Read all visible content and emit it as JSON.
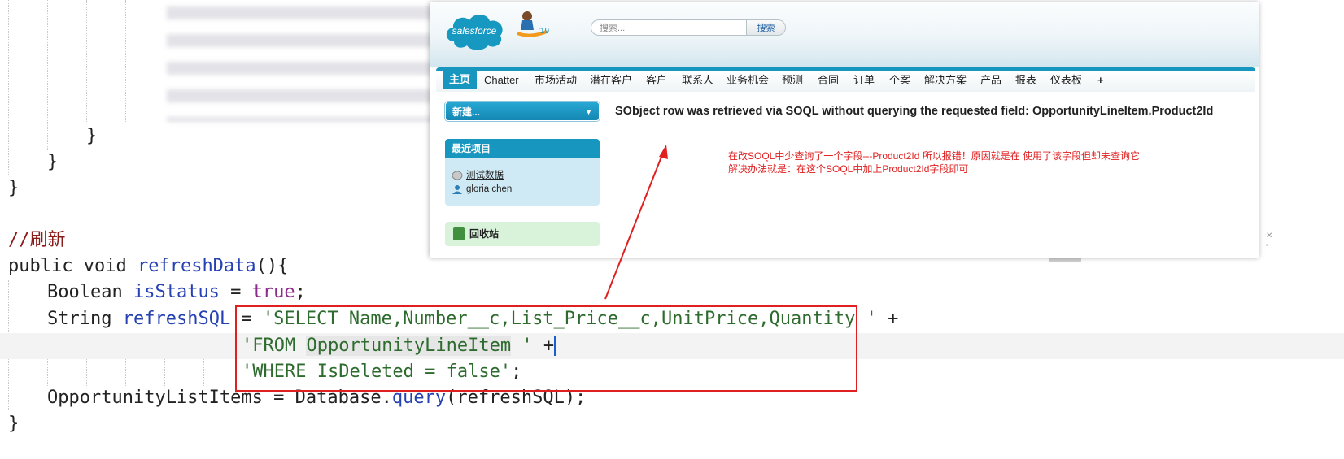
{
  "editor": {
    "brace_inner": "}",
    "brace_mid": "}",
    "brace_outer": "}",
    "comment": "//刷新",
    "decl": {
      "kw_public": "public",
      "kw_void": "void",
      "method": "refreshData",
      "rest": "(){"
    },
    "bool_line": {
      "type": "Boolean",
      "var": "isStatus",
      "eq": " = ",
      "value": "true",
      "end": ";"
    },
    "sql_line1": {
      "type": "String",
      "var": "refreshSQL",
      "eq": " = ",
      "str": "'SELECT Name,Number__c,List_Price__c,UnitPrice,Quantity '",
      "op": " +"
    },
    "sql_line2": {
      "str_a": "'FROM ",
      "str_b": "OpportunityLineItem",
      "str_c": " '",
      "op": " +"
    },
    "sql_line3": {
      "str": "'WHERE IsDeleted = false'",
      "end": ";"
    },
    "query_line": {
      "lhs": "OpportunityListItems",
      "eq": " = ",
      "obj": "Database",
      "dot": ".",
      "method": "query",
      "open": "(",
      "arg": "refreshSQL",
      "close": ");"
    },
    "brace_end": "}"
  },
  "salesforce": {
    "logo_text": "salesforce",
    "release_badge": "'19",
    "search": {
      "placeholder": "搜索...",
      "button": "搜索"
    },
    "tabs": [
      "主页",
      "Chatter",
      "市场活动",
      "潜在客户",
      "客户",
      "联系人",
      "业务机会",
      "预测",
      "合同",
      "订单",
      "个案",
      "解决方案",
      "产品",
      "报表",
      "仪表板",
      "+"
    ],
    "new_dropdown": "新建...",
    "recent_header": "最近项目",
    "recent_items": [
      "测试数据",
      "gloria chen"
    ],
    "recycle_bin": "回收站",
    "error_message": "SObject row was retrieved via SOQL without querying the requested field: OpportunityLineItem.Product2Id"
  },
  "annotation": {
    "line1": "在改SOQL中少查询了一个字段---Product2Id 所以报错！原因就是在 使用了该字段但却未查询它",
    "line2": "解决办法就是：在这个SOQL中加上Product2Id字段即可"
  },
  "colors": {
    "annotation_red": "#e02020",
    "salesforce_blue": "#1797c0",
    "code_identifier": "#2541b2",
    "code_string": "#2e6b2e",
    "code_boolean": "#8b2b8b",
    "code_comment": "#8b1a1a"
  }
}
